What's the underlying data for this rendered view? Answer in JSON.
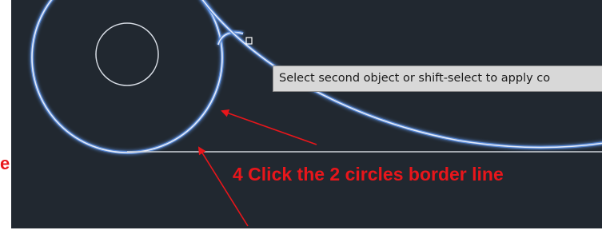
{
  "tooltip": {
    "text": "Select second object or shift-select to apply co"
  },
  "annotation": {
    "instruction": "4 Click the 2 circles border line",
    "edge_fragment": "e"
  },
  "colors": {
    "canvas_background": "#212830",
    "geometry_line": "#e6ecf8",
    "selection_glow": "#5a8bd8",
    "annotation_red": "#e8161b",
    "tooltip_background": "#d8d8d8"
  },
  "icons": {
    "cursor": "pickbox-cursor-icon",
    "arrows": "red-arrow-icon"
  }
}
